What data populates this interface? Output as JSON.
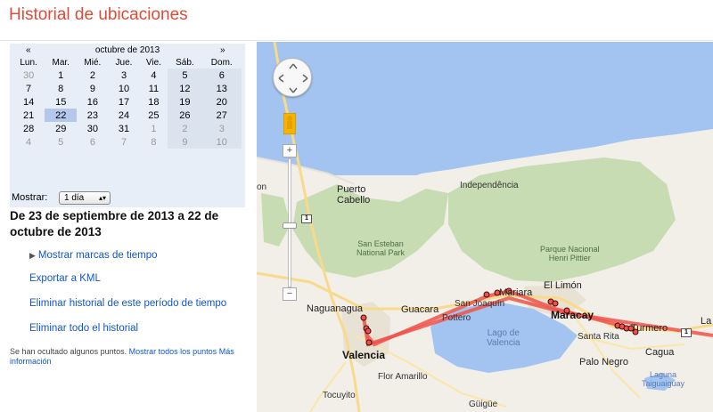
{
  "header": {
    "title": "Historial de ubicaciones"
  },
  "calendar": {
    "prev": "«",
    "next": "»",
    "month": "octubre de 2013",
    "weekdays": [
      "Lun.",
      "Mar.",
      "Mié.",
      "Jue.",
      "Vie.",
      "Sáb.",
      "Dom."
    ],
    "weeks": [
      [
        "30",
        "1",
        "2",
        "3",
        "4",
        "5",
        "6"
      ],
      [
        "7",
        "8",
        "9",
        "10",
        "11",
        "12",
        "13"
      ],
      [
        "14",
        "15",
        "16",
        "17",
        "18",
        "19",
        "20"
      ],
      [
        "21",
        "22",
        "23",
        "24",
        "25",
        "26",
        "27"
      ],
      [
        "28",
        "29",
        "30",
        "31",
        "1",
        "2",
        "3"
      ],
      [
        "4",
        "5",
        "6",
        "7",
        "8",
        "9",
        "10"
      ]
    ],
    "selected": "22"
  },
  "show": {
    "label": "Mostrar:",
    "value": "1 día"
  },
  "range_text": "De 23 de septiembre de 2013 a 22 de octubre de 2013",
  "links": {
    "timestamps": "Mostrar marcas de tiempo",
    "export_kml": "Exportar a KML",
    "delete_period": "Eliminar historial de este período de tiempo",
    "delete_all": "Eliminar todo el historial"
  },
  "note": {
    "text": "Se han ocultado algunos puntos.",
    "show_all": "Mostrar todos los puntos",
    "more_info": "Más información"
  },
  "map": {
    "labels": {
      "puerto_cabello": "Puerto\nCabello",
      "independencia": "Independência",
      "san_esteban": "San Esteban\nNational Park",
      "parque_pittier": "Parque Nacional\nHenri Pittier",
      "naguanagua": "Naguanagua",
      "guacara": "Guacara",
      "san_joaquin": "San Joaquín",
      "mariara": "Mariara",
      "el_limon": "El Limón",
      "maracay": "Maracay",
      "santa_rita": "Santa Rita",
      "turmero": "Turmero",
      "valencia": "Valencia",
      "lago_valencia": "Lago de\nValencia",
      "palo_negro": "Palo Negro",
      "cagua": "Cagua",
      "laguna_taiguaiguay": "Laguna\nTaiguaiguay",
      "flor_amarillo": "Flor Amarillo",
      "tocuyito": "Tocuyito",
      "guigue": "Güigüe",
      "pottero": "Pottero",
      "la": "La",
      "moron_fragment": "on",
      "road_1": "1"
    },
    "zoom_in": "+",
    "zoom_out": "−",
    "colors": {
      "route": "#f0524a",
      "sea": "#a3c4f0",
      "land": "#f2efe9",
      "park": "#c8dcb4"
    }
  }
}
